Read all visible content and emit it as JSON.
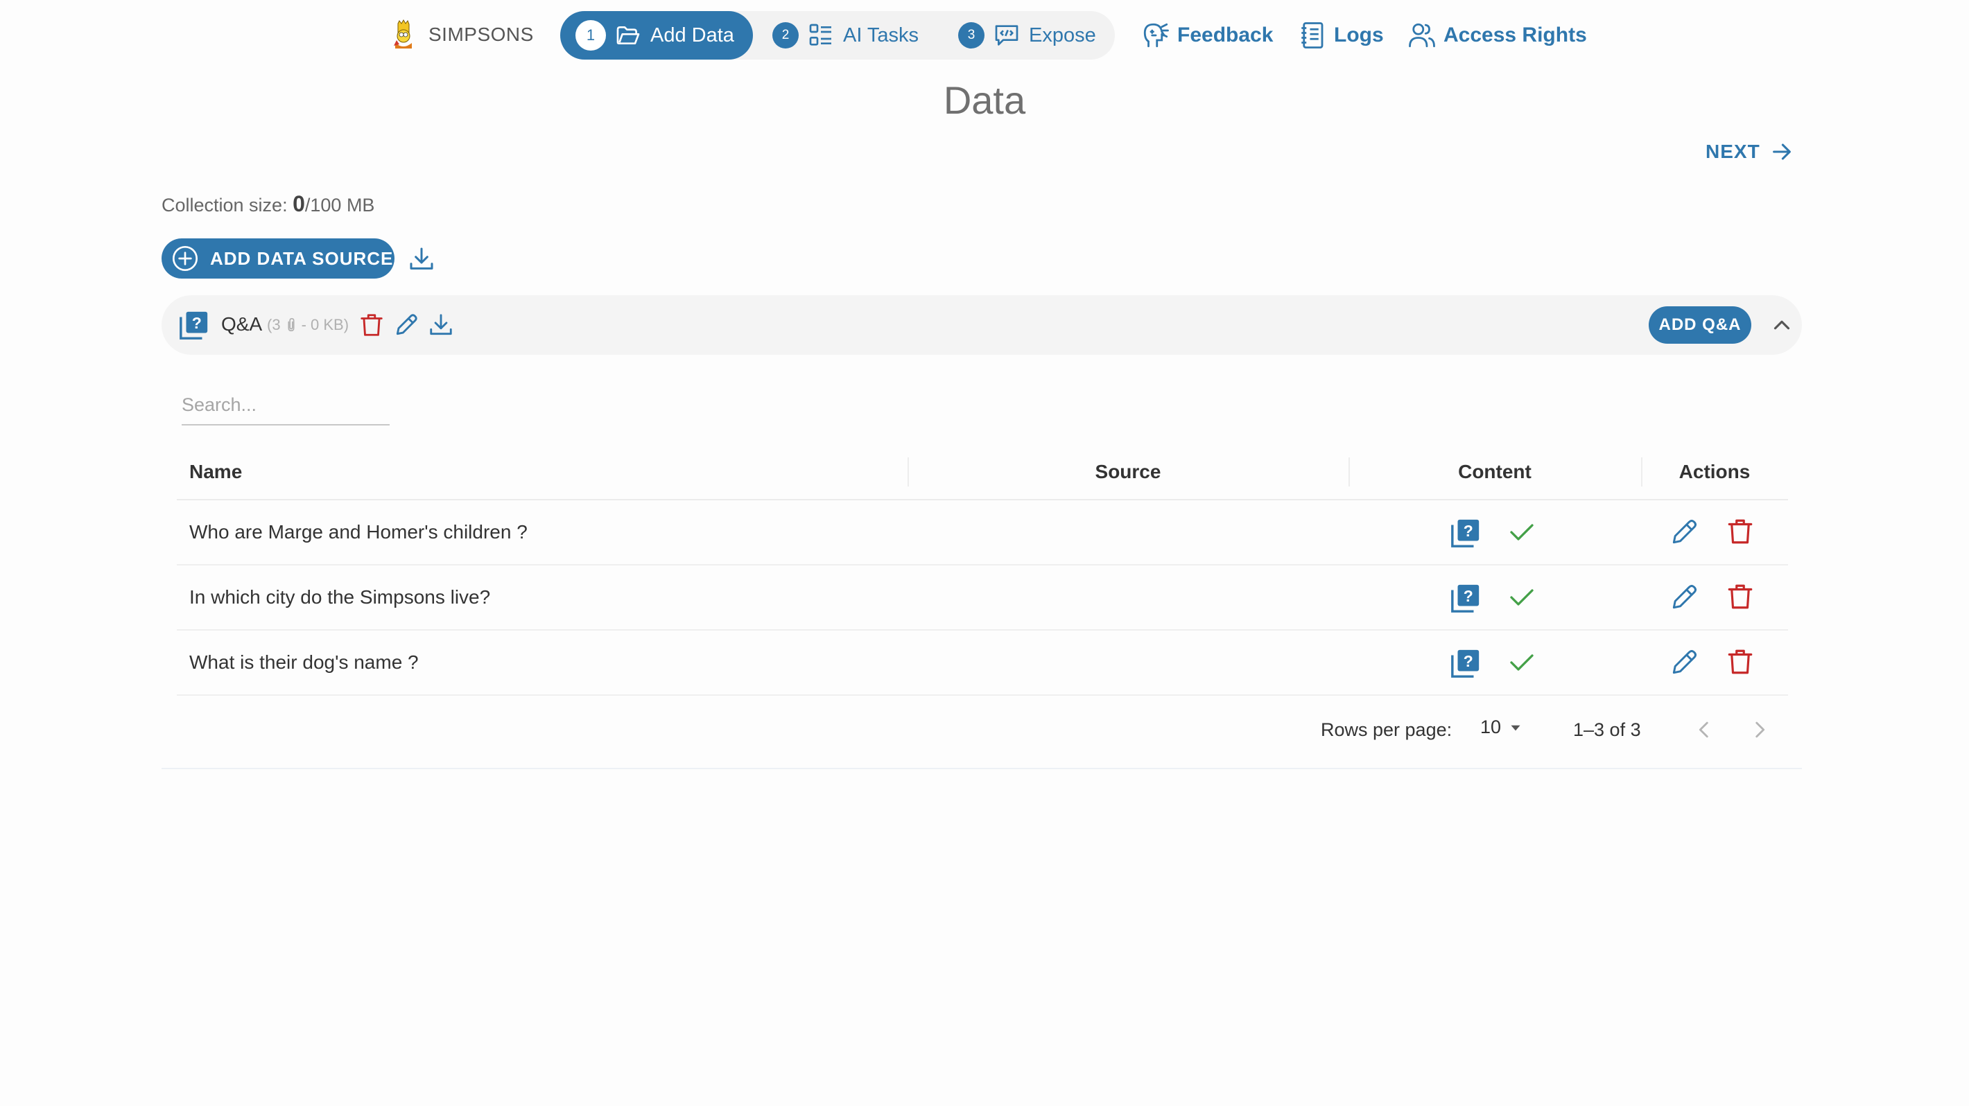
{
  "nav": {
    "brand": "SIMPSONS",
    "steps": [
      {
        "num": "1",
        "label": "Add Data",
        "icon": "folder-open-icon",
        "active": true
      },
      {
        "num": "2",
        "label": "AI Tasks",
        "icon": "list-icon",
        "active": false
      },
      {
        "num": "3",
        "label": "Expose",
        "icon": "chat-code-icon",
        "active": false
      }
    ],
    "links": [
      {
        "label": "Feedback",
        "icon": "feedback-head-icon"
      },
      {
        "label": "Logs",
        "icon": "logs-notebook-icon"
      },
      {
        "label": "Access Rights",
        "icon": "users-icon"
      }
    ]
  },
  "page": {
    "title": "Data",
    "next_label": "NEXT",
    "collection_size_label": "Collection size:",
    "collection_size_value": "0",
    "collection_size_limit": "/100 MB",
    "add_source_label": "ADD DATA SOURCE"
  },
  "collection": {
    "name": "Q&A",
    "meta_open": "(3",
    "meta_close": "- 0 KB)",
    "add_label": "ADD Q&A"
  },
  "search": {
    "placeholder": "Search..."
  },
  "table": {
    "columns": [
      "Name",
      "Source",
      "Content",
      "Actions"
    ],
    "rows": [
      {
        "name": "Who are Marge and Homer's children ?",
        "source": ""
      },
      {
        "name": "In which city do the Simpsons live?",
        "source": ""
      },
      {
        "name": "What is their dog's name ?",
        "source": ""
      }
    ]
  },
  "pagination": {
    "rows_per_page_label": "Rows per page:",
    "rows_per_page": "10",
    "range": "1–3 of 3"
  },
  "colors": {
    "accent": "#2f77ad",
    "danger": "#c62828",
    "success": "#43a047"
  }
}
